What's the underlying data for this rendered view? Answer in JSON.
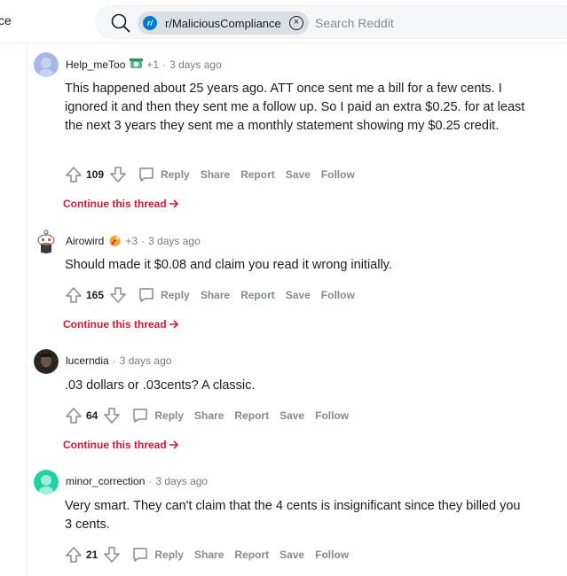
{
  "header": {
    "left_partial_text": "ce",
    "search_chip_label": "r/MaliciousCompliance",
    "search_badge": "r/",
    "search_placeholder": "Search Reddit"
  },
  "actions_labels": {
    "reply": "Reply",
    "share": "Share",
    "report": "Report",
    "save": "Save",
    "follow": "Follow"
  },
  "continue_label": "Continue this thread",
  "comments": [
    {
      "author": "Help_meToo",
      "flair_count": "+1",
      "time": "3 days ago",
      "body": "This happened about 25 years ago. ATT once sent me a bill for a few cents. I ignored it and then they sent me a follow up. So I paid an extra $0.25. for at least the next 3 years they sent me a monthly statement showing my $0.25 credit.",
      "score": "109"
    },
    {
      "author": "Airowird",
      "flair_count": "+3",
      "time": "3 days ago",
      "body": "Should made it $0.08 and claim you read it wrong initially.",
      "score": "165"
    },
    {
      "author": "lucerndia",
      "time": "3 days ago",
      "body": ".03 dollars or .03cents? A classic.",
      "score": "64"
    },
    {
      "author": "minor_correction",
      "time": "3 days ago",
      "body": "Very smart. They can't claim that the 4 cents is insignificant since they billed you 3 cents.",
      "score": "21"
    }
  ],
  "colors": {
    "accent_continue": "#ca1d3c",
    "action_gray": "#878a8c",
    "chip_bg": "#dae0e6",
    "badge_blue": "#0079d3"
  }
}
